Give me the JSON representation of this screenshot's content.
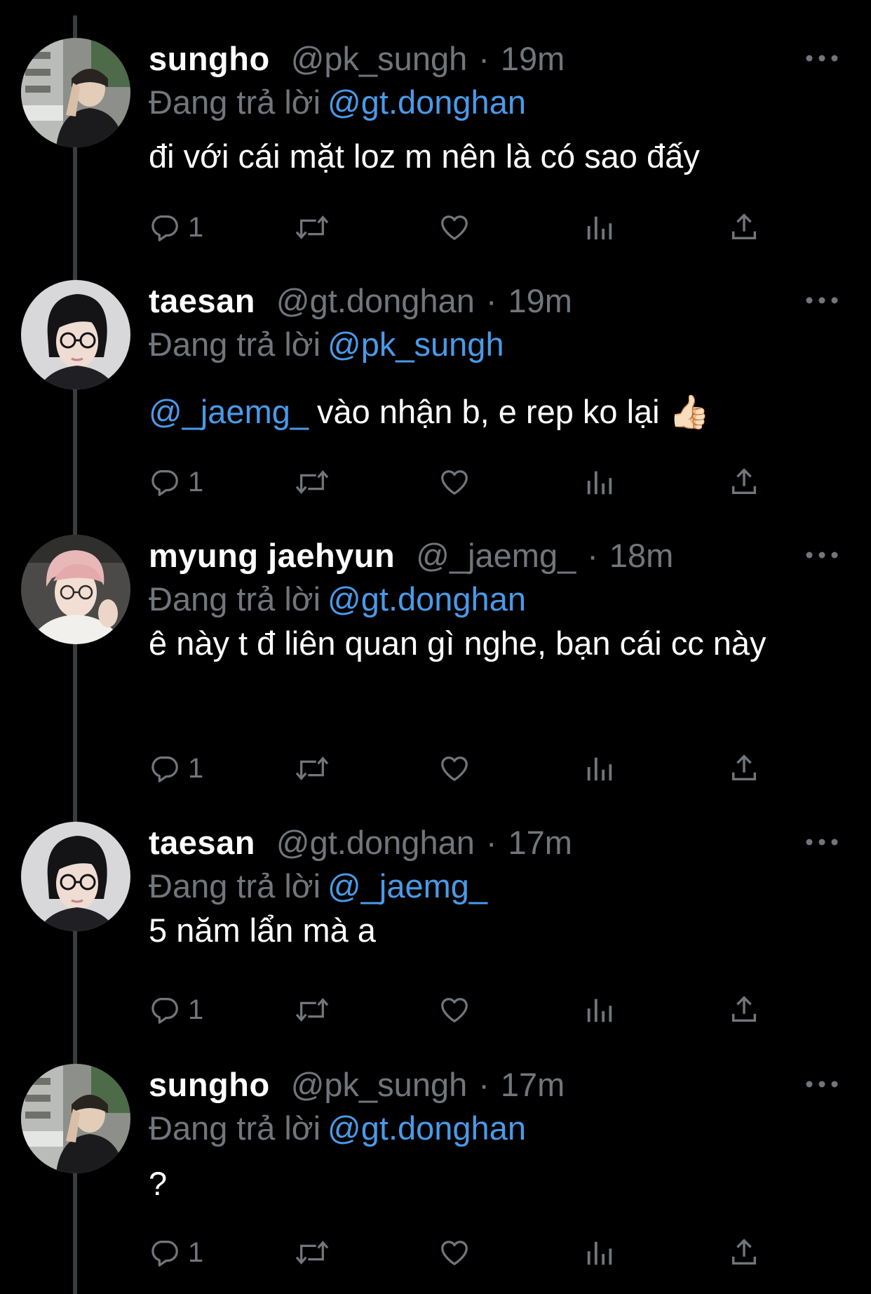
{
  "colors": {
    "background": "#000000",
    "name": "#ffffff",
    "muted": "#71767b",
    "link": "#4a9ae8",
    "thread_line": "#3a3d40"
  },
  "tweets": [
    {
      "name": "sungho",
      "handle": "@pk_sungh",
      "separator": "·",
      "time": "19m",
      "reply_label": "Đang trả lời",
      "reply_to": "@gt.donghan",
      "mention": "",
      "text": "đi với cái mặt loz m nên là có sao đấy",
      "reply_count": "1"
    },
    {
      "name": "taesan",
      "handle": "@gt.donghan",
      "separator": "·",
      "time": "19m",
      "reply_label": "Đang trả lời",
      "reply_to": "@pk_sungh",
      "mention": "@_jaemg_",
      "text": "vào nhận b, e rep ko lại 👍🏻",
      "reply_count": "1"
    },
    {
      "name": "myung jaehyun",
      "handle": "@_jaemg_",
      "separator": "·",
      "time": "18m",
      "reply_label": "Đang trả lời",
      "reply_to": "@gt.donghan",
      "mention": "",
      "text": "ê này t đ liên quan gì nghe, bạn cái cc này",
      "reply_count": "1"
    },
    {
      "name": "taesan",
      "handle": "@gt.donghan",
      "separator": "·",
      "time": "17m",
      "reply_label": "Đang trả lời",
      "reply_to": "@_jaemg_",
      "mention": "",
      "text": "5 năm lẩn mà a",
      "reply_count": "1"
    },
    {
      "name": "sungho",
      "handle": "@pk_sungh",
      "separator": "·",
      "time": "17m",
      "reply_label": "Đang trả lời",
      "reply_to": "@gt.donghan",
      "mention": "",
      "text": "?",
      "reply_count": "1"
    }
  ],
  "icons": {
    "more": "more-horizontal-icon",
    "reply": "reply-bubble-icon",
    "retweet": "retweet-icon",
    "like": "heart-icon",
    "views": "views-bars-icon",
    "share": "share-icon"
  }
}
